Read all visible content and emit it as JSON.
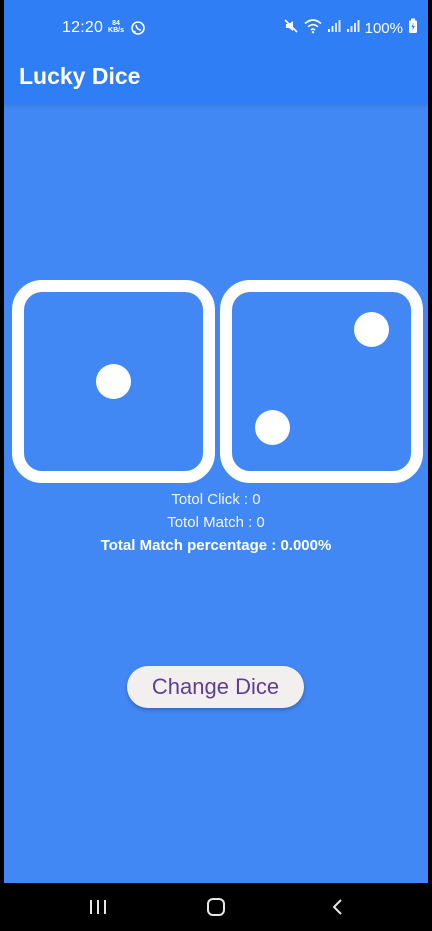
{
  "status_bar": {
    "time": "12:20",
    "data_rate_value": "84",
    "data_rate_unit": "KB/s",
    "battery_percent": "100%",
    "icons": [
      "whatsapp-icon",
      "mute-icon",
      "wifi-icon",
      "signal-icon",
      "signal-icon",
      "battery-charging-icon"
    ]
  },
  "app_bar": {
    "title": "Lucky Dice"
  },
  "dice": {
    "left_value": 1,
    "right_value": 2
  },
  "stats": {
    "total_click": "Totol Click : 0",
    "total_match": "Totol Match : 0",
    "match_percentage": "Total Match percentage : 0.000%"
  },
  "actions": {
    "change_dice_label": "Change Dice"
  },
  "navigation": {
    "icons": [
      "recent-apps-icon",
      "home-icon",
      "back-icon"
    ]
  },
  "colors": {
    "background": "#4288f4",
    "app_bar": "#2f7ef5",
    "button_background": "#f3efef",
    "button_text": "#5d3f95",
    "dice": "#ffffff"
  }
}
